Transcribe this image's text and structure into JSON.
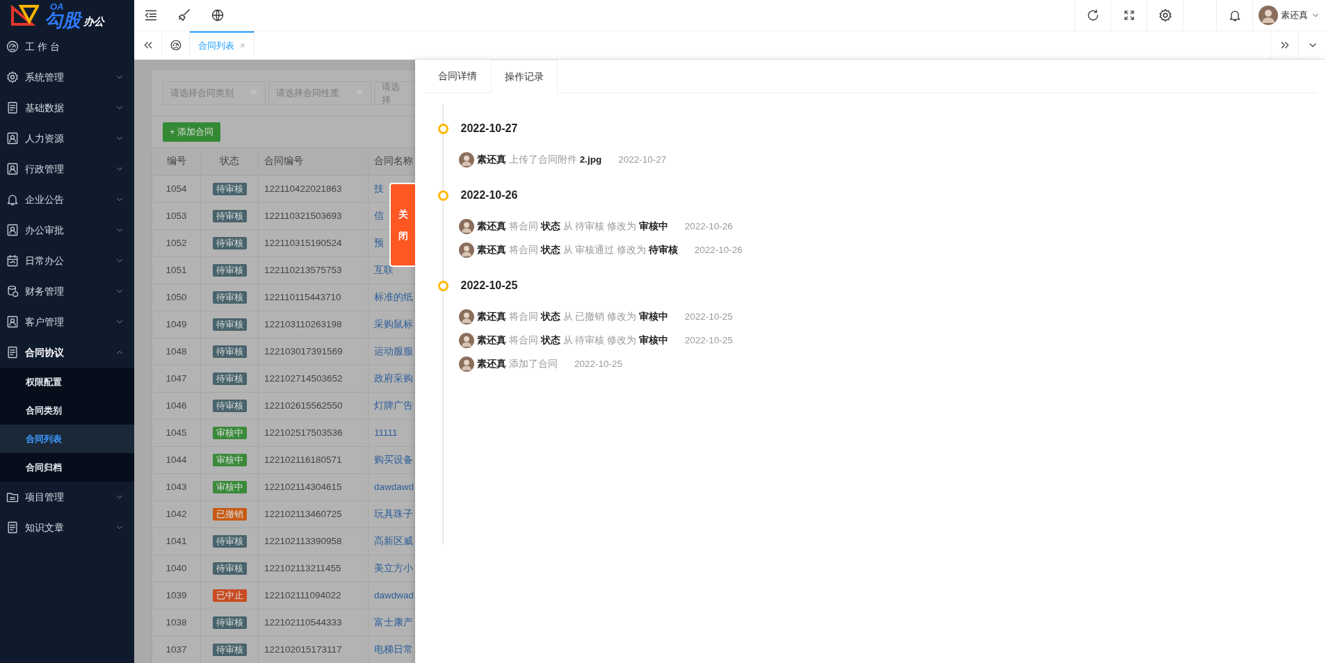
{
  "logo": {
    "badge": "OA",
    "main": "勾股",
    "small": "办公"
  },
  "sidebar": {
    "items": [
      {
        "label": "工 作 台",
        "kind": "link",
        "expanded": false
      },
      {
        "label": "系统管理",
        "kind": "group",
        "expanded": false
      },
      {
        "label": "基础数据",
        "kind": "group",
        "expanded": false
      },
      {
        "label": "人力资源",
        "kind": "group",
        "expanded": false
      },
      {
        "label": "行政管理",
        "kind": "group",
        "expanded": false
      },
      {
        "label": "企业公告",
        "kind": "group",
        "expanded": false
      },
      {
        "label": "办公审批",
        "kind": "group",
        "expanded": false
      },
      {
        "label": "日常办公",
        "kind": "group",
        "expanded": false
      },
      {
        "label": "财务管理",
        "kind": "group",
        "expanded": false
      },
      {
        "label": "客户管理",
        "kind": "group",
        "expanded": false
      },
      {
        "label": "合同协议",
        "kind": "group",
        "expanded": true,
        "children": [
          {
            "label": "权限配置",
            "selected": false
          },
          {
            "label": "合同类别",
            "selected": false
          },
          {
            "label": "合同列表",
            "selected": true
          },
          {
            "label": "合同归档",
            "selected": false
          }
        ]
      },
      {
        "label": "项目管理",
        "kind": "group",
        "expanded": false
      },
      {
        "label": "知识文章",
        "kind": "group",
        "expanded": false
      }
    ]
  },
  "topbar": {
    "user": "素还真"
  },
  "tabs": [
    {
      "label": "合同列表",
      "selected": true,
      "close": "×"
    }
  ],
  "filters": [
    {
      "placeholder": "请选择合同类别"
    },
    {
      "placeholder": "请选择合同性质"
    },
    {
      "placeholder": "请选择"
    }
  ],
  "add_button": "+ 添加合同",
  "table": {
    "columns": [
      "编号",
      "状态",
      "合同编号",
      "合同名称"
    ],
    "rows": [
      {
        "id": "1054",
        "status": "待审核",
        "color": "#48636b",
        "number": "122110422021863",
        "name": "技"
      },
      {
        "id": "1053",
        "status": "待审核",
        "color": "#48636b",
        "number": "122110321503693",
        "name": "信"
      },
      {
        "id": "1052",
        "status": "待审核",
        "color": "#48636b",
        "number": "122110315190524",
        "name": "预"
      },
      {
        "id": "1051",
        "status": "待审核",
        "color": "#48636b",
        "number": "122110213575753",
        "name": "互联"
      },
      {
        "id": "1050",
        "status": "待审核",
        "color": "#48636b",
        "number": "122110115443710",
        "name": "标准的纸"
      },
      {
        "id": "1049",
        "status": "待审核",
        "color": "#48636b",
        "number": "122103110263198",
        "name": "采购鼠标"
      },
      {
        "id": "1048",
        "status": "待审核",
        "color": "#48636b",
        "number": "122103017391569",
        "name": "运动服服"
      },
      {
        "id": "1047",
        "status": "待审核",
        "color": "#48636b",
        "number": "122102714503652",
        "name": "政府采购"
      },
      {
        "id": "1046",
        "status": "待审核",
        "color": "#48636b",
        "number": "122102615562550",
        "name": "灯牌广告"
      },
      {
        "id": "1045",
        "status": "审核中",
        "color": "#3a8a3a",
        "number": "122102517503536",
        "name": "11111"
      },
      {
        "id": "1044",
        "status": "审核中",
        "color": "#3a8a3a",
        "number": "122102116180571",
        "name": "购买设备"
      },
      {
        "id": "1043",
        "status": "审核中",
        "color": "#3a8a3a",
        "number": "122102114304615",
        "name": "dawdawd"
      },
      {
        "id": "1042",
        "status": "已撤销",
        "color": "#c65a14",
        "number": "122102113460725",
        "name": "玩具珠子"
      },
      {
        "id": "1041",
        "status": "待审核",
        "color": "#48636b",
        "number": "122102113390958",
        "name": "高新区威"
      },
      {
        "id": "1040",
        "status": "待审核",
        "color": "#48636b",
        "number": "122102113211455",
        "name": "美立方小"
      },
      {
        "id": "1039",
        "status": "已中止",
        "color": "#c84b21",
        "number": "122102111094022",
        "name": "dawdwad"
      },
      {
        "id": "1038",
        "status": "待审核",
        "color": "#48636b",
        "number": "122102110544333",
        "name": "富士康产"
      },
      {
        "id": "1037",
        "status": "待审核",
        "color": "#48636b",
        "number": "122102015173117",
        "name": "电梯日常"
      }
    ]
  },
  "drawer": {
    "close_label": "关闭",
    "tabs": [
      {
        "label": "合同详情",
        "selected": false
      },
      {
        "label": "操作记录",
        "selected": true
      }
    ],
    "timeline": [
      {
        "date": "2022-10-27",
        "entries": [
          {
            "user": "素还真",
            "action": "上传了合同附件 **2.jpg**",
            "time": "2022-10-27"
          }
        ]
      },
      {
        "date": "2022-10-26",
        "entries": [
          {
            "user": "素还真",
            "action": "将合同 **状态** 从 待审核 修改为 **审核中**",
            "time": "2022-10-26"
          },
          {
            "user": "素还真",
            "action": "将合同 **状态** 从 审核通过 修改为 **待审核**",
            "time": "2022-10-26"
          }
        ]
      },
      {
        "date": "2022-10-25",
        "entries": [
          {
            "user": "素还真",
            "action": "将合同 **状态** 从 已撤销 修改为 **审核中**",
            "time": "2022-10-25"
          },
          {
            "user": "素还真",
            "action": "将合同 **状态** 从 待审核 修改为 **审核中**",
            "time": "2022-10-25"
          },
          {
            "user": "素还真",
            "action": "添加了合同",
            "time": "2022-10-25"
          }
        ]
      }
    ]
  }
}
